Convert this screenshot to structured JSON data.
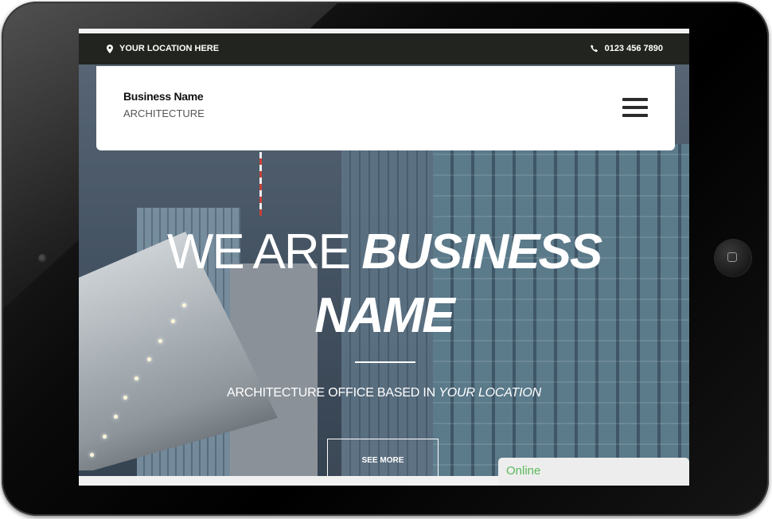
{
  "topbar": {
    "location_icon": "map-marker-icon",
    "location_text": "YOUR LOCATION HERE",
    "phone_icon": "phone-icon",
    "phone_text": "0123 456 7890"
  },
  "navbar": {
    "brand_name": "Business Name",
    "brand_subtitle": "ARCHITECTURE",
    "menu_icon": "hamburger-menu-icon"
  },
  "hero": {
    "title_light": "WE ARE",
    "title_bold_1": "BUSINESS",
    "title_bold_2": "NAME",
    "subtitle_prefix": "ARCHITECTURE OFFICE BASED IN",
    "subtitle_emphasis": "YOUR LOCATION",
    "cta_label": "SEE MORE"
  },
  "chat": {
    "status_label": "Online",
    "status_color": "#5cb85c"
  },
  "device": {
    "home_button_icon": "home-button-icon",
    "camera_icon": "camera-icon"
  }
}
